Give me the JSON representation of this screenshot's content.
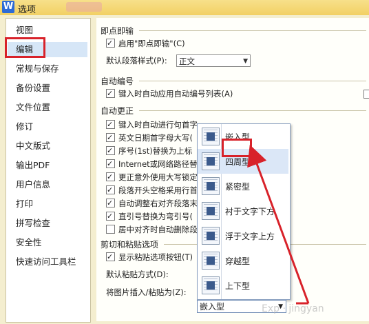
{
  "window": {
    "app_icon_letter": "W",
    "title": "选项"
  },
  "sidebar": {
    "items": [
      {
        "label": "视图"
      },
      {
        "label": "编辑"
      },
      {
        "label": "常规与保存"
      },
      {
        "label": "备份设置"
      },
      {
        "label": "文件位置"
      },
      {
        "label": "修订"
      },
      {
        "label": "中文版式"
      },
      {
        "label": "输出PDF"
      },
      {
        "label": "用户信息"
      },
      {
        "label": "打印"
      },
      {
        "label": "拼写检查"
      },
      {
        "label": "安全性"
      },
      {
        "label": "快速访问工具栏"
      }
    ],
    "selected_index": 1
  },
  "click_and_type": {
    "title": "即点即输",
    "enable_label": "启用\"即点即输\"(C)",
    "enable_checked": true,
    "default_style_label": "默认段落样式(P):",
    "default_style_value": "正文"
  },
  "auto_numbering": {
    "title": "自动编号",
    "apply_label": "键入时自动应用自动编号列表(A)",
    "apply_checked": true
  },
  "auto_correct": {
    "title": "自动更正",
    "items": [
      {
        "label": "键入时自动进行句首字",
        "checked": true
      },
      {
        "label": "英文日期首字母大写(",
        "checked": true
      },
      {
        "label": "序号(1st)替换为上标",
        "checked": true
      },
      {
        "label": "Internet或网络路径替",
        "checked": true
      },
      {
        "label": "更正意外使用大写锁定",
        "checked": true
      },
      {
        "label": "段落开头空格采用行首",
        "checked": true
      },
      {
        "label": "自动调整右对齐段落末",
        "checked": true
      },
      {
        "label": "直引号替换为弯引号(",
        "checked": true
      },
      {
        "label": "居中对齐时自动删除段",
        "checked": false
      }
    ]
  },
  "cut_paste": {
    "title": "剪切和粘贴选项",
    "show_button_label": "显示粘贴选项按钮(T)",
    "show_button_checked": true,
    "default_paste_label": "默认粘贴方式(D):",
    "insert_picture_label": "将图片插入/粘贴为(Z):",
    "insert_picture_value": "嵌入型"
  },
  "wrap_dropdown": {
    "options": [
      {
        "label": "嵌入型"
      },
      {
        "label": "四周型"
      },
      {
        "label": "紧密型"
      },
      {
        "label": "衬于文字下方"
      },
      {
        "label": "浮于文字上方"
      },
      {
        "label": "穿越型"
      },
      {
        "label": "上下型"
      }
    ],
    "hovered_index": 1
  },
  "colors": {
    "annotation_red": "#d8222a",
    "selection_blue": "#d6e6f7"
  }
}
